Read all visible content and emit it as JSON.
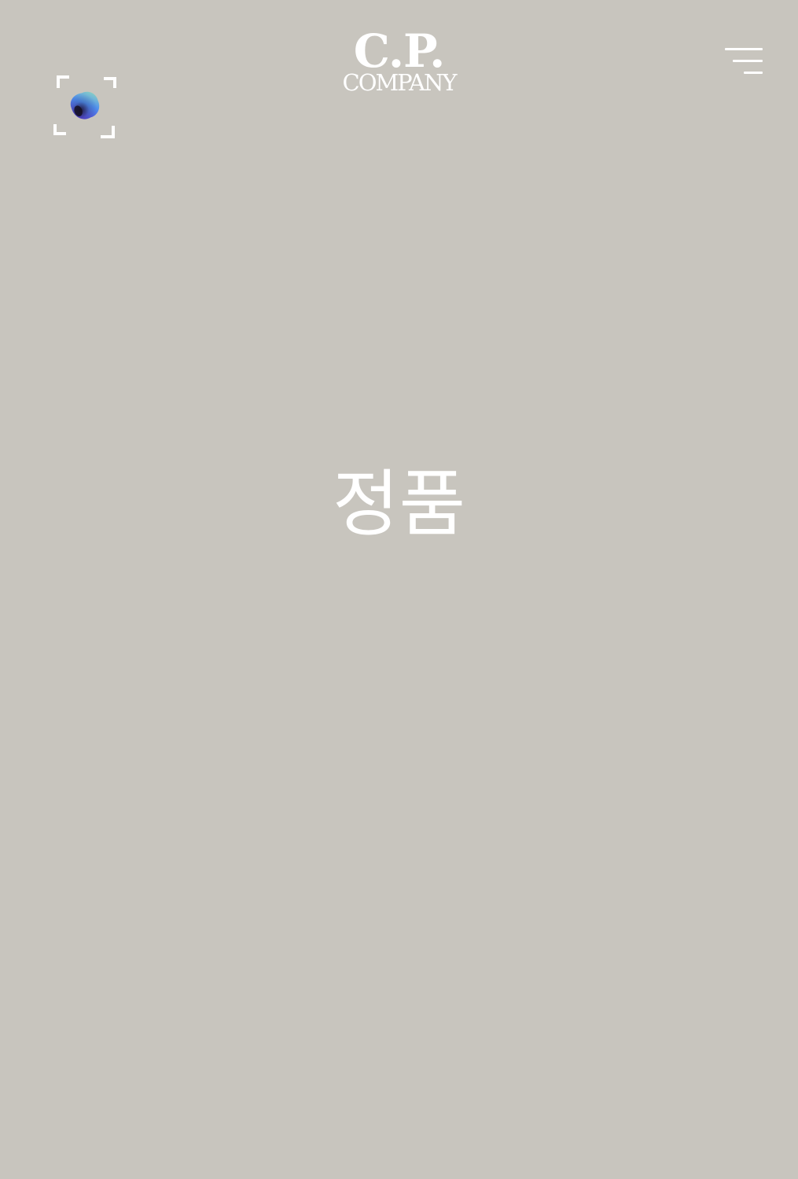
{
  "header": {
    "logo_line1": "C.P.",
    "logo_line2": "COMPANY",
    "scan_icon": "camera-scan-icon",
    "menu_icon": "hamburger-menu-icon"
  },
  "main": {
    "title": "정품"
  },
  "colors": {
    "background": "#c8c5be",
    "foreground": "#ffffff"
  }
}
